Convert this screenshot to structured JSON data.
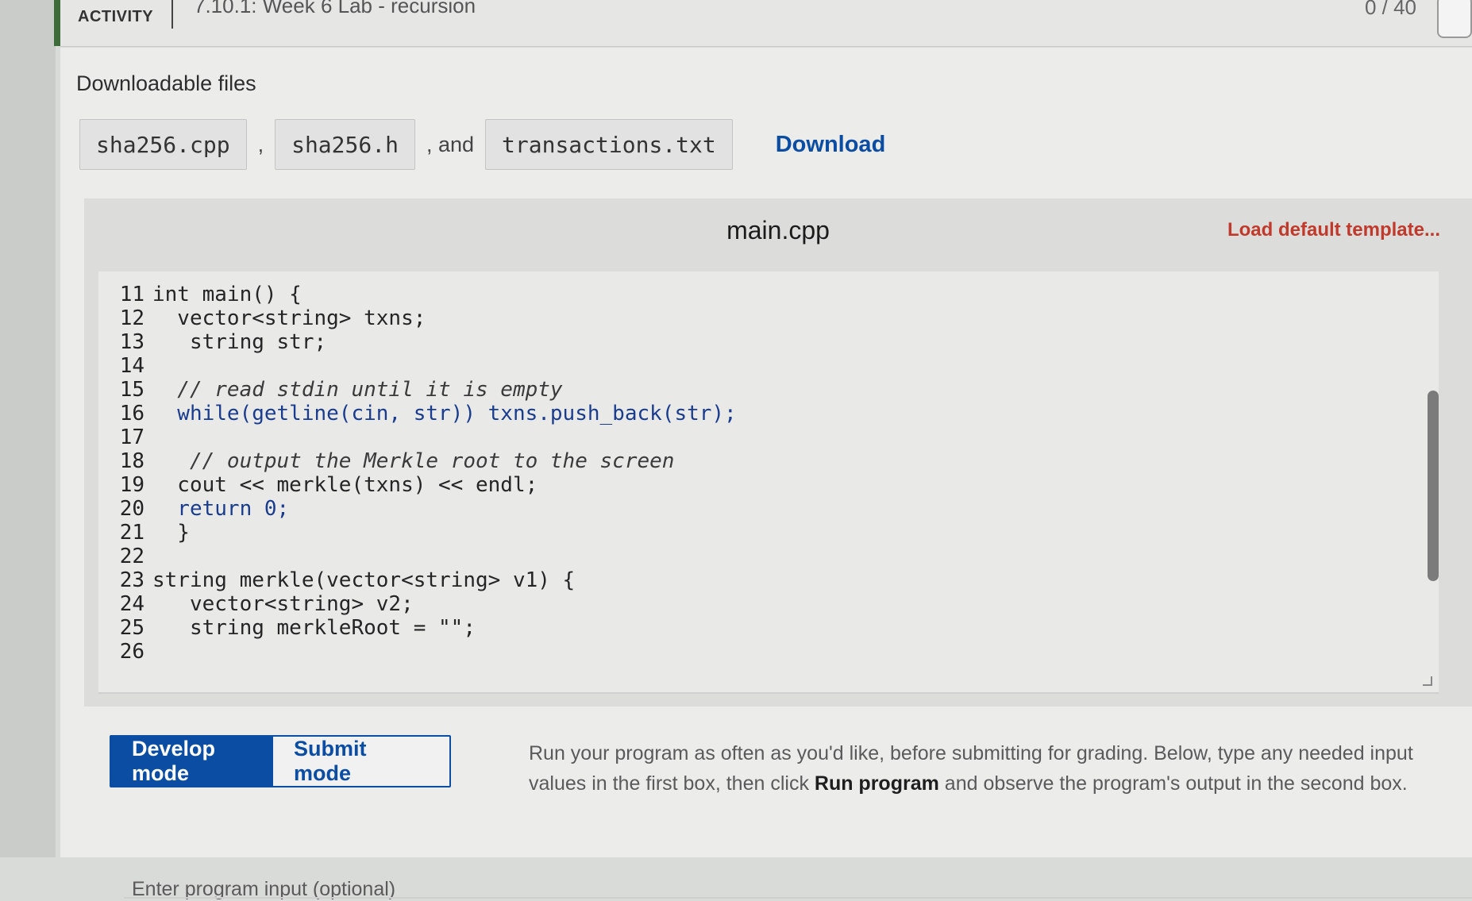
{
  "topbar": {
    "activity_label": "ACTIVITY",
    "title": "7.10.1: Week 6 Lab - recursion",
    "score": "0 / 40"
  },
  "downloads": {
    "title": "Downloadable files",
    "files": [
      "sha256.cpp",
      "sha256.h",
      "transactions.txt"
    ],
    "separator_comma": ",",
    "separator_and": ", and",
    "download_label": "Download"
  },
  "editor": {
    "filename": "main.cpp",
    "load_default_label": "Load default template...",
    "lines": [
      {
        "n": "11",
        "text": "int main() {"
      },
      {
        "n": "12",
        "text": "  vector<string> txns;"
      },
      {
        "n": "13",
        "text": "   string str;"
      },
      {
        "n": "14",
        "text": ""
      },
      {
        "n": "15",
        "text": "  // read stdin until it is empty"
      },
      {
        "n": "16",
        "text": "  while(getline(cin, str)) txns.push_back(str);"
      },
      {
        "n": "17",
        "text": ""
      },
      {
        "n": "18",
        "text": "   // output the Merkle root to the screen"
      },
      {
        "n": "19",
        "text": "  cout << merkle(txns) << endl;"
      },
      {
        "n": "20",
        "text": "  return 0;"
      },
      {
        "n": "21",
        "text": "  }"
      },
      {
        "n": "22",
        "text": ""
      },
      {
        "n": "23",
        "text": "string merkle(vector<string> v1) {"
      },
      {
        "n": "24",
        "text": "   vector<string> v2;"
      },
      {
        "n": "25",
        "text": "   string merkleRoot = \"\";"
      },
      {
        "n": "26",
        "text": ""
      }
    ]
  },
  "modes": {
    "develop": "Develop mode",
    "submit": "Submit mode"
  },
  "help": {
    "part1": "Run your program as often as you'd like, before submitting for grading. Below, type any needed input values in the first box, then click ",
    "bold": "Run program",
    "part2": " and observe the program's output in the second box."
  },
  "input": {
    "label": "Enter program input (optional)"
  }
}
